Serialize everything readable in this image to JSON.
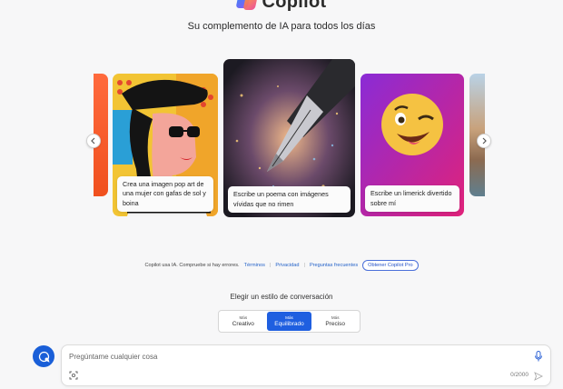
{
  "header": {
    "title": "Copilot",
    "subtitle": "Su complemento de IA para todos los días"
  },
  "carousel": {
    "prev_icon": "chevron-left-icon",
    "next_icon": "chevron-right-icon",
    "cards": [
      {
        "caption": "Crea una imagen pop art de una mujer con gafas de sol y boina"
      },
      {
        "caption": "Escribe un poema con imágenes vívidas que no rimen"
      },
      {
        "caption": "Escribe un limerick divertido sobre mí"
      }
    ]
  },
  "footer": {
    "notice": "Copilot usa IA. Compruebe si hay errores.",
    "terms": "Términos",
    "privacy": "Privacidad",
    "faq": "Preguntas frecuentes",
    "pro_button": "Obtener Copilot Pro"
  },
  "style_selector": {
    "label": "Elegir un estilo de conversación",
    "options": [
      {
        "small": "Más",
        "big": "Creativo",
        "active": false
      },
      {
        "small": "Más",
        "big": "Equilibrado",
        "active": true
      },
      {
        "small": "Más",
        "big": "Preciso",
        "active": false
      }
    ]
  },
  "input": {
    "placeholder": "Pregúntame cualquier cosa",
    "value": "",
    "counter": "0/2000"
  },
  "colors": {
    "accent": "#1f5fe0",
    "background": "#f7f7f8"
  }
}
